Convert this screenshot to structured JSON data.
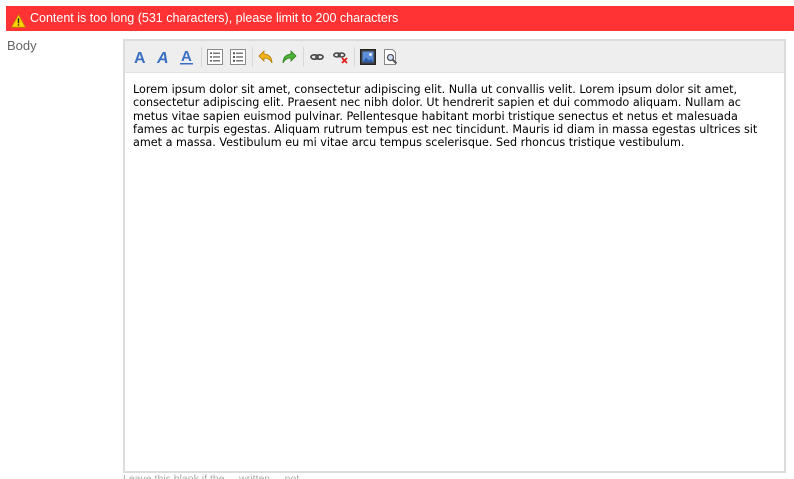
{
  "error": {
    "icon": "warning-icon",
    "message": "Content is too long (531 characters), please limit to 200 characters",
    "color": "#ff3333"
  },
  "field": {
    "label": "Body"
  },
  "toolbar": {
    "buttons": [
      "bold-icon",
      "italic-icon",
      "underline-icon",
      "ordered-list-icon",
      "unordered-list-icon",
      "undo-icon",
      "redo-icon",
      "link-icon",
      "unlink-icon",
      "image-icon",
      "preview-icon"
    ]
  },
  "editor": {
    "content": "Lorem ipsum dolor sit amet, consectetur adipiscing elit. Nulla ut convallis velit. Lorem ipsum dolor sit amet, consectetur adipiscing elit. Praesent nec nibh dolor. Ut hendrerit sapien et dui commodo aliquam. Nullam ac metus vitae sapien euismod pulvinar. Pellentesque habitant morbi tristique senectus et netus et malesuada fames ac turpis egestas. Aliquam rutrum tempus est nec tincidunt. Mauris id diam in massa egestas ultrices sit amet a massa. Vestibulum eu mi vitae arcu tempus scelerisque. Sed rhoncus tristique vestibulum."
  },
  "hint": {
    "text": "Leave this blank if the ... written ... not ..."
  }
}
